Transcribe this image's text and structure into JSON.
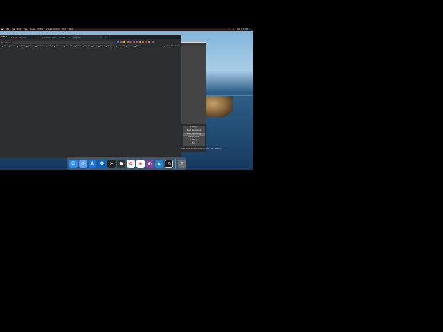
{
  "menubar": {
    "items": [
      "OBS",
      "File",
      "Edit",
      "View",
      "Docks",
      "Profile",
      "Scene Collection",
      "Tools",
      "Help"
    ],
    "status": "Mon 3:33 PM"
  },
  "browser": {
    "tabs": [
      {
        "title": "OBS - YouTube"
      },
      {
        "title": "Untitled video - YouTube"
      },
      {
        "title": "New Tab"
      }
    ],
    "omnibox_placeholder": "",
    "bookmarks": [
      "Apps",
      "Gmail",
      "YouTube",
      "Google",
      "Facebook",
      "Netflix",
      "Amazon",
      "Wikipedia",
      "Twitter",
      "Reddit",
      "Maps",
      "News",
      "Weather",
      "Translate",
      "Photos",
      "Drive"
    ],
    "other_bookmarks": "Other Bookmarks"
  },
  "context_menu": {
    "items": [
      "Settings",
      "Start Streaming",
      "Start Recording",
      "Studio Mode",
      "Settings",
      "Exit"
    ],
    "selected_index": 2
  },
  "obs_status": "LIVE: 00:00:00  REC: 00:00:00  CPU: 3.5%, 30.00 fps",
  "dock": {
    "apps": [
      {
        "name": "finder",
        "glyph": "☺",
        "color": "#2f8cf0"
      },
      {
        "name": "launchpad",
        "glyph": "◍",
        "color": "#5c9cf5"
      },
      {
        "name": "app-store",
        "glyph": "A",
        "color": "#1a73e8"
      },
      {
        "name": "outlook",
        "glyph": "O",
        "color": "#0a64c2"
      },
      {
        "name": "terminal",
        "glyph": ">_",
        "color": "#222222"
      },
      {
        "name": "photo-booth",
        "glyph": "●",
        "color": "#333333"
      },
      {
        "name": "photos",
        "glyph": "✿",
        "color": "#f4f4f4"
      },
      {
        "name": "chrome",
        "glyph": "◉",
        "color": "#e94235"
      },
      {
        "name": "tor-browser",
        "glyph": "◐",
        "color": "#7d4698"
      },
      {
        "name": "vscode",
        "glyph": "◣",
        "color": "#1f84d4"
      },
      {
        "name": "obs",
        "glyph": "◎",
        "color": "#1b1b1b"
      },
      {
        "name": "trash",
        "glyph": "🗑",
        "color": "#6f7378"
      }
    ]
  },
  "colors": {
    "window_bg": "#2b2c2e",
    "menu_selected": "#6b6b6b"
  }
}
